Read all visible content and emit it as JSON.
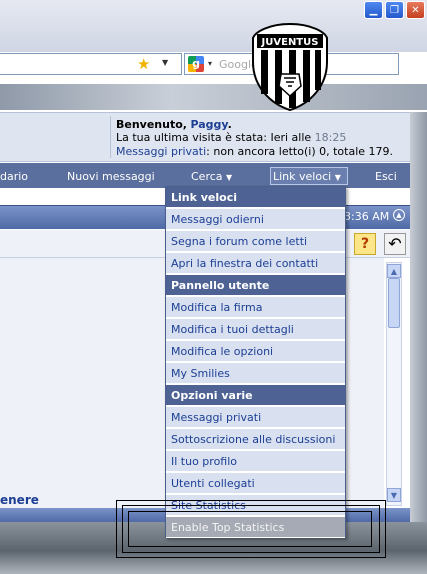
{
  "browser": {
    "google_placeholder": "Google",
    "window_buttons": [
      "minimize",
      "restore",
      "close"
    ]
  },
  "logo": {
    "text": "JUVENTUS"
  },
  "welcome": {
    "greeting_prefix": "Benvenuto,",
    "username": "Paggy",
    "greeting_suffix": ".",
    "last_visit_label": "La tua ultima visita è stata: Ieri alle",
    "last_visit_time": "18:25",
    "pm_link": "Messaggi privati",
    "pm_status": ": non ancora letto(i) 0, totale 179."
  },
  "nav": {
    "calendar": "dario",
    "new_messages": "Nuovi messaggi",
    "search": "Cerca",
    "quick_links": "Link veloci",
    "logout": "Esci"
  },
  "forum": {
    "time": "3:36 AM",
    "genere_text": "enere",
    "help_label": "?"
  },
  "menu": {
    "items": [
      {
        "label": "Link veloci",
        "type": "header"
      },
      {
        "label": "Messaggi odierni",
        "type": "item"
      },
      {
        "label": "Segna i forum come letti",
        "type": "item"
      },
      {
        "label": "Apri la finestra dei contatti",
        "type": "item"
      },
      {
        "label": "Pannello utente",
        "type": "header"
      },
      {
        "label": "Modifica la firma",
        "type": "item"
      },
      {
        "label": "Modifica i tuoi dettagli",
        "type": "item"
      },
      {
        "label": "Modifica le opzioni",
        "type": "item"
      },
      {
        "label": "My Smilies",
        "type": "item"
      },
      {
        "label": "Opzioni varie",
        "type": "header"
      },
      {
        "label": "Messaggi privati",
        "type": "item"
      },
      {
        "label": "Sottoscrizione alle discussioni",
        "type": "item"
      },
      {
        "label": "Il tuo profilo",
        "type": "item"
      },
      {
        "label": "Utenti collegati",
        "type": "item"
      },
      {
        "label": "Site Statistics",
        "type": "item"
      },
      {
        "label": "Enable Top Statistics",
        "type": "item-dim"
      }
    ]
  },
  "colors": {
    "nav_bg": "#5a6f9d",
    "menu_header_bg": "#4e6394",
    "menu_item_bg": "#d9e1f0",
    "link": "#1c3f94"
  }
}
